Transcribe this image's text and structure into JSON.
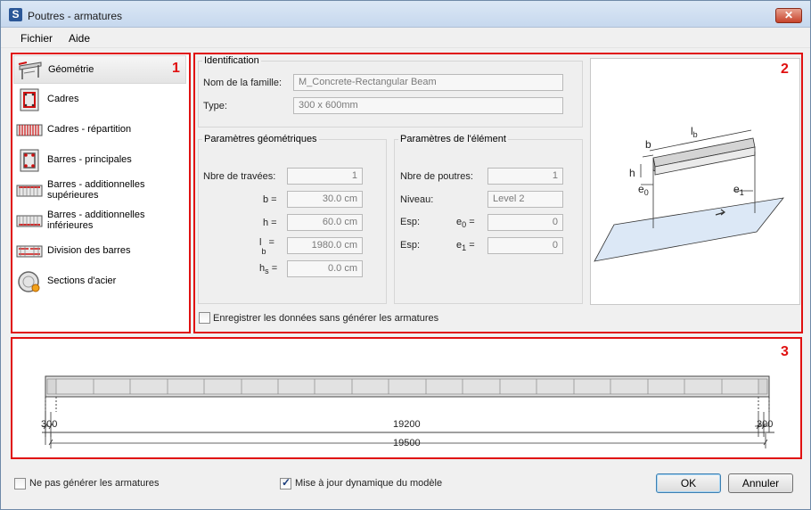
{
  "window": {
    "title": "Poutres - armatures",
    "app_icon_letter": "S",
    "close_symbol": "✕"
  },
  "menu": {
    "items": [
      "Fichier",
      "Aide"
    ]
  },
  "regions": {
    "nav_number": "1",
    "preview_number": "2",
    "beam_number": "3"
  },
  "nav": {
    "items": [
      {
        "label": "Géométrie",
        "icon": "geometry-icon",
        "selected": true
      },
      {
        "label": "Cadres",
        "icon": "stirrup-icon"
      },
      {
        "label": "Cadres - répartition",
        "icon": "stirrup-distribution-icon"
      },
      {
        "label": "Barres - principales",
        "icon": "main-bars-icon"
      },
      {
        "label": "Barres - additionnelles supérieures",
        "icon": "top-bars-icon"
      },
      {
        "label": "Barres - additionnelles inférieures",
        "icon": "bottom-bars-icon"
      },
      {
        "label": "Division des barres",
        "icon": "bar-division-icon"
      },
      {
        "label": "Sections d'acier",
        "icon": "steel-sections-icon"
      }
    ]
  },
  "identification": {
    "title": "Identification",
    "family_label": "Nom de la famille:",
    "family_value": "M_Concrete-Rectangular Beam",
    "type_label": "Type:",
    "type_value": "300 x 600mm"
  },
  "geometry": {
    "title": "Paramètres géométriques",
    "spans_label": "Nbre de travées:",
    "spans_value": "1",
    "b_label": "b =",
    "b_value": "30.0 cm",
    "h_label": "h =",
    "h_value": "60.0 cm",
    "lb_main": "l",
    "lb_sub": "b",
    "lb_eq": "=",
    "lb_value": "1980.0 cm",
    "hs_main": "h",
    "hs_sub": "s",
    "hs_eq": "=",
    "hs_value": "0.0 cm"
  },
  "element": {
    "title": "Paramètres de l'élément",
    "beams_label": "Nbre de poutres:",
    "beams_value": "1",
    "level_label": "Niveau:",
    "level_value": "Level 2",
    "esp_label": "Esp:",
    "e0_main": "e",
    "e0_sub": "0",
    "e0_eq": "=",
    "e0_value": "0",
    "esp2_label": "Esp:",
    "e1_main": "e",
    "e1_sub": "1",
    "e1_eq": "=",
    "e1_value": "0"
  },
  "preview": {
    "lb": "l",
    "lb_sub": "b",
    "b": "b",
    "h": "h",
    "e0": "e",
    "e0_sub": "0",
    "e1": "e",
    "e1_sub": "1"
  },
  "save_without": {
    "label": "Enregistrer les données sans générer les armatures",
    "checked": false
  },
  "beam_diagram": {
    "left_support": "300",
    "span": "19200",
    "right_support": "300",
    "total": "19500"
  },
  "footer": {
    "no_generate_label": "Ne pas générer les armatures",
    "no_generate_checked": false,
    "dynamic_update_label": "Mise à jour dynamique du modèle",
    "dynamic_update_checked": true,
    "ok_label": "OK",
    "cancel_label": "Annuler"
  },
  "colors": {
    "highlight_red": "#e01010",
    "window_border": "#6f8aa8"
  }
}
